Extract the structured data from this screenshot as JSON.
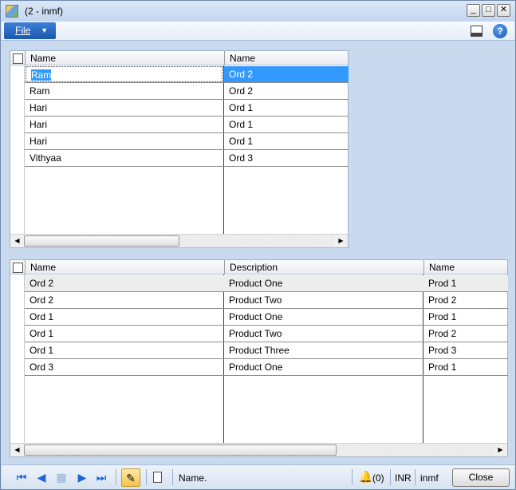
{
  "window": {
    "title": "(2 - inmf)",
    "minimize_glyph": "_",
    "maximize_glyph": "□",
    "close_glyph": "✕"
  },
  "menu": {
    "file_label": "File",
    "help_glyph": "?"
  },
  "top_grid": {
    "columns": [
      "Name",
      "Name"
    ],
    "rows": [
      [
        "Ram",
        "Ord 2"
      ],
      [
        "Ram",
        "Ord 2"
      ],
      [
        "Hari",
        "Ord 1"
      ],
      [
        "Hari",
        "Ord 1"
      ],
      [
        "Hari",
        "Ord 1"
      ],
      [
        "Vithyaa",
        "Ord 3"
      ]
    ]
  },
  "bottom_grid": {
    "columns": [
      "Name",
      "Description",
      "Name"
    ],
    "rows": [
      [
        "Ord 2",
        "Product One",
        "Prod 1"
      ],
      [
        "Ord 2",
        "Product Two",
        "Prod 2"
      ],
      [
        "Ord 1",
        "Product One",
        "Prod 1"
      ],
      [
        "Ord 1",
        "Product Two",
        "Prod 2"
      ],
      [
        "Ord 1",
        "Product Three",
        "Prod 3"
      ],
      [
        "Ord 3",
        "Product One",
        "Prod 1"
      ]
    ]
  },
  "status": {
    "field_help": "Name.",
    "notifications": "(0)",
    "currency": "INR",
    "company": "inmf",
    "close_label": "Close"
  },
  "icons": {
    "first": "first-record-icon",
    "previous": "previous-record-icon",
    "grid": "grid-view-icon",
    "next": "next-record-icon",
    "last": "last-record-icon",
    "edit": "edit-pencil-icon",
    "attach": "attachment-icon",
    "bell": "notification-bell-icon"
  },
  "colors": {
    "selection": "#3399ff",
    "menu_blue": "#1b57b0",
    "nav_blue": "#1a64d6"
  }
}
